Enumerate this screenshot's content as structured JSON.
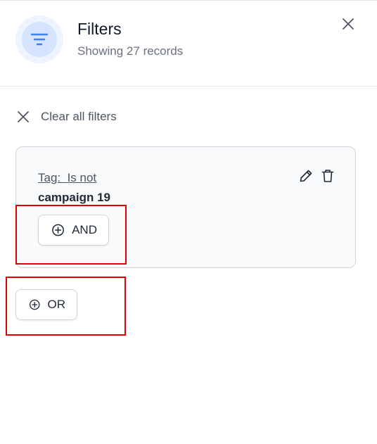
{
  "header": {
    "title": "Filters",
    "subtitle": "Showing 27 records",
    "icon": "filter-icon",
    "close_icon": "close-icon"
  },
  "clear_all": {
    "icon": "close-icon",
    "label": "Clear all filters"
  },
  "filter_group": {
    "condition_label": "Tag:  Is not",
    "value": "campaign 19",
    "edit_icon": "pencil-icon",
    "delete_icon": "trash-icon",
    "and_button": {
      "icon": "plus-circle-icon",
      "label": "AND"
    }
  },
  "or_button": {
    "icon": "plus-circle-icon",
    "label": "OR"
  },
  "colors": {
    "accent": "#3b82f6",
    "icon_bg": "#d6e4ff",
    "highlight": "#e00000",
    "card_bg": "#f9fafb"
  }
}
